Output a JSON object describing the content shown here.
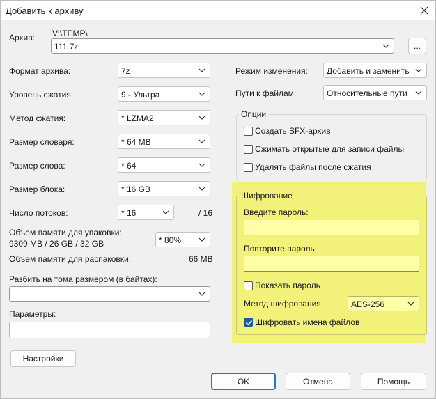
{
  "window": {
    "title": "Добавить к архиву"
  },
  "archive": {
    "label": "Архив:",
    "path": "V:\\TEMP\\",
    "filename": "111.7z",
    "browse_label": "..."
  },
  "left": {
    "format": {
      "label": "Формат архива:",
      "value": "7z"
    },
    "level": {
      "label": "Уровень сжатия:",
      "value": "9 - Ультра"
    },
    "method": {
      "label": "Метод сжатия:",
      "value": "*  LZMA2"
    },
    "dict": {
      "label": "Размер словаря:",
      "value": "*  64 MB"
    },
    "word": {
      "label": "Размер слова:",
      "value": "*  64"
    },
    "block": {
      "label": "Размер блока:",
      "value": "*  16 GB"
    },
    "threads": {
      "label": "Число потоков:",
      "value": "*  16",
      "max": "/ 16"
    },
    "mem_pack": {
      "label": "Объем памяти для упаковки:",
      "info": "9309 MB / 26 GB / 32 GB",
      "value": "*  80%"
    },
    "mem_unpack": {
      "label": "Объем памяти для распаковки:",
      "value": "66 MB"
    },
    "split": {
      "label": "Разбить на тома размером (в байтах):",
      "value": ""
    },
    "params": {
      "label": "Параметры:",
      "value": ""
    },
    "settings_button": "Настройки"
  },
  "right": {
    "update_mode": {
      "label": "Режим изменения:",
      "value": "Добавить и заменить"
    },
    "path_mode": {
      "label": "Пути к файлам:",
      "value": "Относительные пути"
    },
    "options": {
      "title": "Опции",
      "items": [
        {
          "label": "Создать SFX-архив",
          "checked": false
        },
        {
          "label": "Сжимать открытые для записи файлы",
          "checked": false
        },
        {
          "label": "Удалять файлы после сжатия",
          "checked": false
        }
      ]
    },
    "encryption": {
      "title": "Шифрование",
      "password_label": "Введите пароль:",
      "password_value": "",
      "repeat_label": "Повторите пароль:",
      "repeat_value": "",
      "show_password_label": "Показать пароль",
      "show_password_checked": false,
      "method_label": "Метод шифрования:",
      "method_value": "AES-256",
      "encrypt_names_label": "Шифровать имена файлов",
      "encrypt_names_checked": true,
      "highlight_color": "#f2f27a"
    }
  },
  "footer": {
    "ok": "OK",
    "cancel": "Отмена",
    "help": "Помощь"
  },
  "colors": {
    "accent": "#2f6fd1",
    "checkbox_checked": "#1f5aa8",
    "background": "#f0f0f0"
  }
}
